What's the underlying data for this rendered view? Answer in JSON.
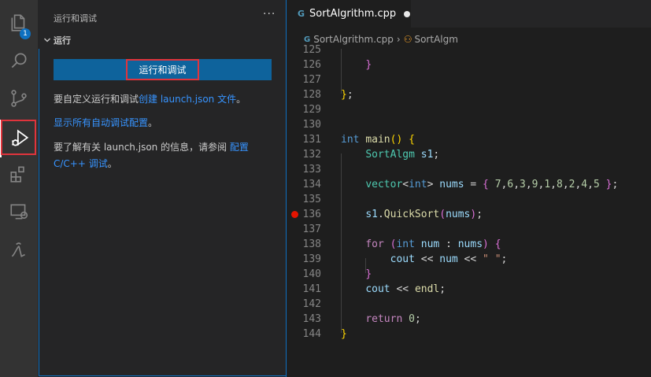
{
  "activity_bar": {
    "explorer_badge": "1"
  },
  "sidebar": {
    "title": "运行和调试",
    "more": "···",
    "section_title": "运行",
    "run_button": "运行和调试",
    "text1_prefix": "要自定义运行和调试",
    "text1_link": "创建 launch.json 文件",
    "text1_suffix": "。",
    "text2_link": "显示所有自动调试配置",
    "text2_suffix": "。",
    "text3_prefix": "要了解有关 launch.json 的信息，请参阅 ",
    "text3_link": "配置 C/C++ 调试",
    "text3_suffix": "。"
  },
  "editor": {
    "tab_label": "SortAlgrithm.cpp",
    "tab_icon": "G",
    "breadcrumb_file": "SortAlgrithm.cpp",
    "breadcrumb_symbol": "SortAlgm",
    "breakpoint_line": "136"
  },
  "code": {
    "line_numbers": [
      "125",
      "126",
      "127",
      "128",
      "129",
      "130",
      "131",
      "132",
      "133",
      "134",
      "135",
      "136",
      "137",
      "138",
      "139",
      "140",
      "141",
      "142",
      "143",
      "144"
    ]
  },
  "colors": {
    "accent": "#0e639c",
    "focus_border": "#0e70c0",
    "highlight": "#e0343c",
    "breakpoint": "#e51400"
  }
}
